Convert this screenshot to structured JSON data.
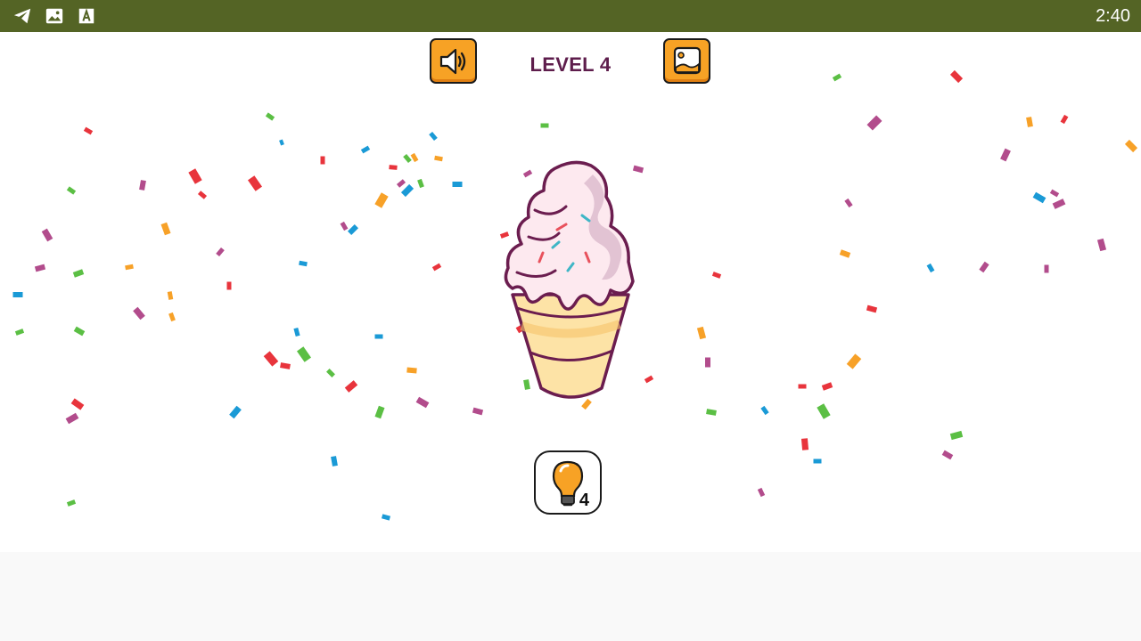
{
  "status_bar": {
    "time": "2:40",
    "icons": [
      "telegram-icon",
      "image-icon",
      "a-letter-icon"
    ]
  },
  "game": {
    "level_label": "LEVEL 4",
    "buttons": {
      "sound": {
        "icon": "speaker-icon"
      },
      "gallery": {
        "icon": "gallery-icon"
      }
    },
    "hint": {
      "icon": "lightbulb-icon",
      "count": "4"
    },
    "picture": {
      "icon": "ice-cream-cone-icon"
    }
  },
  "colors": {
    "status_bar": "#546425",
    "button_orange": "#f7a225",
    "level_text": "#5e1d4c",
    "confetti": [
      "#e8343c",
      "#f7a128",
      "#1a9ad6",
      "#5bbf44",
      "#b24c8c"
    ]
  }
}
